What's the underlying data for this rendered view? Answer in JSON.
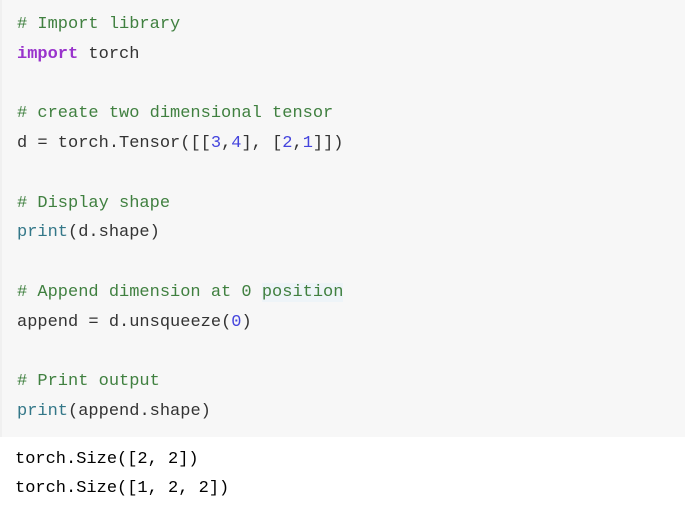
{
  "code": {
    "c1": "# Import library",
    "kw_import": "import",
    "mod_torch": " torch",
    "c2": "# create two dimensional tensor",
    "l4_a": "d ",
    "l4_eq": "=",
    "l4_b": " torch",
    "l4_dot": ".",
    "l4_c": "Tensor",
    "l4_p1": "([[",
    "l4_n1": "3",
    "l4_com1": ",",
    "l4_n2": "4",
    "l4_p2": "], [",
    "l4_n3": "2",
    "l4_com2": ",",
    "l4_n4": "1",
    "l4_p3": "]])",
    "c3": "# Display shape",
    "l6_print": "print",
    "l6_p1": "(",
    "l6_d": "d",
    "l6_dot": ".",
    "l6_shape": "shape",
    "l6_p2": ")",
    "c4a": "# Append dimension at 0 ",
    "c4b": "position",
    "l8_a": "append ",
    "l8_eq": "=",
    "l8_b": " d",
    "l8_dot": ".",
    "l8_c": "unsqueeze",
    "l8_p1": "(",
    "l8_n": "0",
    "l8_p2": ")",
    "c5": "# Print output",
    "l10_print": "print",
    "l10_p1": "(",
    "l10_a": "append",
    "l10_dot": ".",
    "l10_shape": "shape",
    "l10_p2": ")"
  },
  "output": {
    "line1": "torch.Size([2, 2])",
    "line2": "torch.Size([1, 2, 2])"
  }
}
